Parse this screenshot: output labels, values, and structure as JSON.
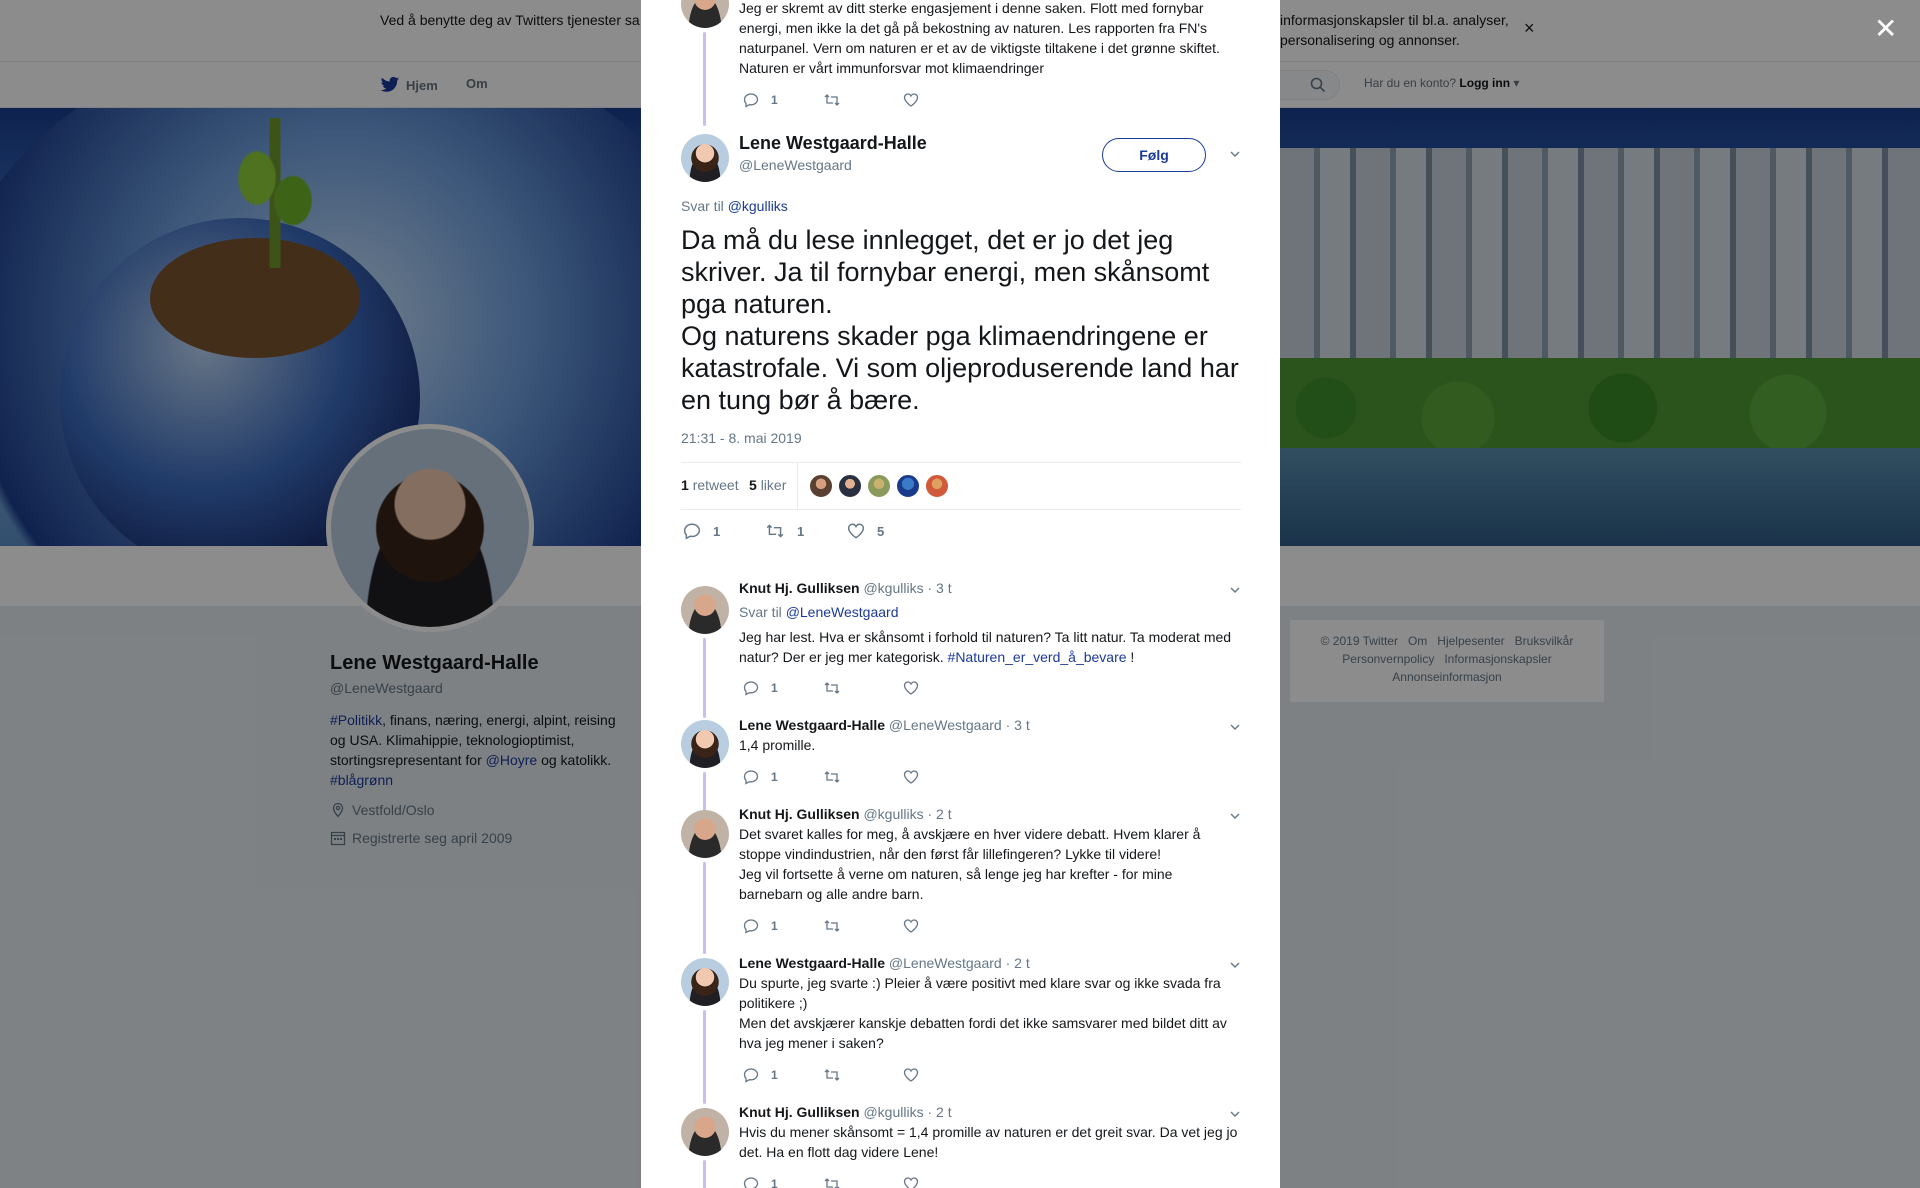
{
  "cookie_banner": {
    "text_left": "Ved å benytte deg av Twitters tjenester sa",
    "text_right": "informasjonskapsler til bl.a. analyser, personalisering og annonser."
  },
  "nav": {
    "home": "Hjem",
    "about": "Om",
    "login_question": "Har du en konto?",
    "login": "Logg inn"
  },
  "profile": {
    "name": "Lene Westgaard-Halle",
    "handle": "@LeneWestgaard",
    "bio_tag1": "#Politikk",
    "bio_text1": ", finans, næring, energi, alpint, reising og USA. Klimahippie, teknologioptimist, stortingsrepresentant for ",
    "bio_mention": "@Hoyre",
    "bio_text2": " og katolikk. ",
    "bio_tag2": "#blågrønn",
    "location": "Vestfold/Oslo",
    "joined": "Registrerte seg april 2009"
  },
  "footer": {
    "copyright": "© 2019 Twitter",
    "about": "Om",
    "help": "Hjelpesenter",
    "terms": "Bruksvilkår",
    "privacy": "Personvernpolicy",
    "cookies": "Informasjonskapsler",
    "ads": "Annonseinformasjon"
  },
  "top_tweet": {
    "text": "Jeg er skremt av ditt sterke engasjement i denne saken. Flott med fornybar energi, men ikke la det gå på bekostning av naturen. Les rapporten fra FN's naturpanel. Vern om naturen er et av de viktigste tiltakene i det grønne skiftet. Naturen er vårt immunforsvar mot klimaendringer",
    "replies": "1"
  },
  "main_tweet": {
    "name": "Lene Westgaard-Halle",
    "handle": "@LeneWestgaard",
    "follow": "Følg",
    "reply_to_prefix": "Svar til",
    "reply_to": "@kgulliks",
    "text_line1": "Da må du lese innlegget, det er jo det jeg skriver. Ja til fornybar energi, men skånsomt pga naturen.",
    "text_line2": "Og naturens skader pga klimaendringene er katastrofale. Vi som oljeproduserende land har en tung bør å bære.",
    "time": "21:31 - 8. mai 2019",
    "retweets": "1",
    "retweets_label": "retweet",
    "likes": "5",
    "likes_label": "liker",
    "reply_count": "1",
    "retweet_count": "1",
    "like_count": "5"
  },
  "replies": [
    {
      "name": "Knut Hj. Gulliksen",
      "handle": "@kgulliks",
      "time": "· 3 t",
      "reply_prefix": "Svar til",
      "reply_to": "@LeneWestgaard",
      "text": "Jeg har lest. Hva er skånsomt i forhold til naturen? Ta litt natur. Ta moderat med natur? Der er jeg mer kategorisk. ",
      "hashtag": "#Naturen_er_verd_å_bevare",
      "text_end": " !",
      "replies": "1"
    },
    {
      "name": "Lene Westgaard-Halle",
      "handle": "@LeneWestgaard",
      "time": "· 3 t",
      "text": "1,4 promille.",
      "replies": "1"
    },
    {
      "name": "Knut Hj. Gulliksen",
      "handle": "@kgulliks",
      "time": "· 2 t",
      "text_line1": "Det svaret kalles for meg, å avskjære en hver videre debatt. Hvem klarer å stoppe vindindustrien, når den først får lillefingeren?  Lykke til videre!",
      "text_line2": "Jeg vil fortsette å verne om naturen, så lenge jeg har krefter - for mine barnebarn og alle andre barn.",
      "replies": "1"
    },
    {
      "name": "Lene Westgaard-Halle",
      "handle": "@LeneWestgaard",
      "time": "· 2 t",
      "text_line1": "Du spurte, jeg svarte :) Pleier å være positivt med klare svar og ikke svada fra politikere ;)",
      "text_line2": "Men det avskjærer kanskje debatten fordi det ikke samsvarer med bildet ditt av hva jeg mener i saken?",
      "replies": "1"
    },
    {
      "name": "Knut Hj. Gulliksen",
      "handle": "@kgulliks",
      "time": "· 2 t",
      "text": "Hvis du mener skånsomt = 1,4 promille av naturen er det greit svar. Da vet jeg jo det. Ha en flott dag videre Lene!",
      "replies": "1"
    }
  ],
  "colors": {
    "link": "#1b3a9a",
    "thread_line": "#c6c0ef",
    "muted": "#657786"
  }
}
